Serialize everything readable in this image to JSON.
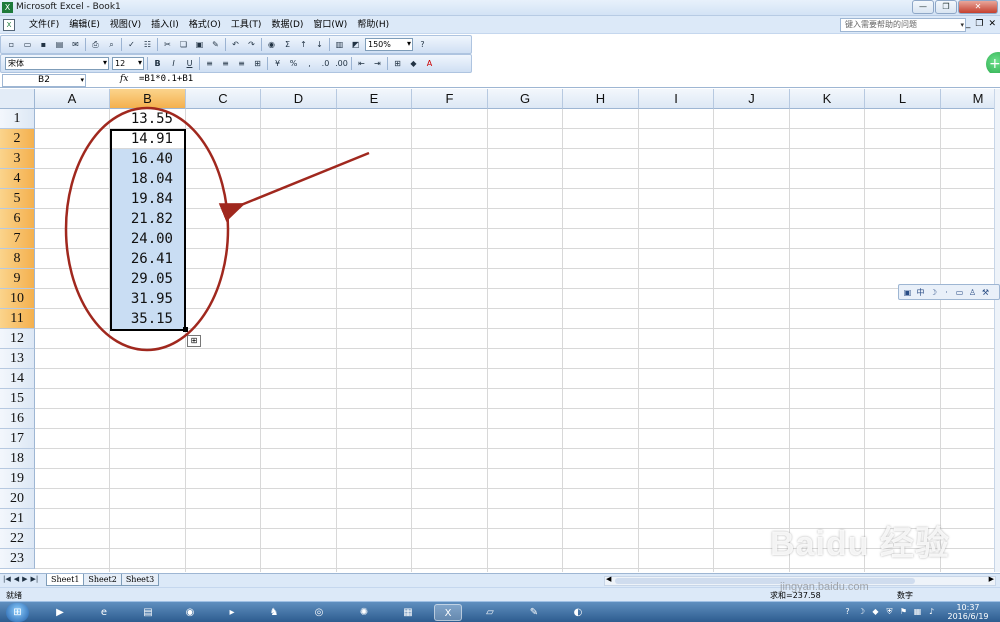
{
  "window": {
    "title": "Microsoft Excel - Book1"
  },
  "menu": {
    "items": [
      "文件(F)",
      "编辑(E)",
      "视图(V)",
      "插入(I)",
      "格式(O)",
      "工具(T)",
      "数据(D)",
      "窗口(W)",
      "帮助(H)"
    ],
    "help_placeholder": "键入需要帮助的问题"
  },
  "toolbar": {
    "zoom": "150%"
  },
  "format_toolbar": {
    "font": "宋体",
    "size": "12",
    "bold": "B",
    "italic": "I",
    "underline": "U"
  },
  "formula_bar": {
    "name_box": "B2",
    "fx": "fx",
    "formula": "=B1*0.1+B1"
  },
  "grid": {
    "columns": [
      "A",
      "B",
      "C",
      "D",
      "E",
      "F",
      "G",
      "H",
      "I",
      "J",
      "K",
      "L",
      "M"
    ],
    "selected_column": "B",
    "rows": [
      "1",
      "2",
      "3",
      "4",
      "5",
      "6",
      "7",
      "8",
      "9",
      "10",
      "11",
      "12",
      "13",
      "14",
      "15",
      "16",
      "17",
      "18",
      "19",
      "20",
      "21",
      "22",
      "23"
    ],
    "selected_rows": [
      "2",
      "3",
      "4",
      "5",
      "6",
      "7",
      "8",
      "9",
      "10",
      "11"
    ],
    "column_b_values": [
      "13.55",
      "14.91",
      "16.40",
      "18.04",
      "19.84",
      "21.82",
      "24.00",
      "26.41",
      "29.05",
      "31.95",
      "35.15"
    ]
  },
  "sheets": {
    "tabs": [
      "Sheet1",
      "Sheet2",
      "Sheet3"
    ],
    "active": "Sheet1"
  },
  "status": {
    "ready": "就绪",
    "sum": "求和=237.58",
    "mode": "数字"
  },
  "taskbar": {
    "time": "10:37",
    "date": "2016/6/19"
  },
  "watermark": {
    "text": "Baidu 经验",
    "url": "jingyan.baidu.com"
  },
  "colors": {
    "annotation": "#a0281e",
    "selection_fill": "#c9ddf3",
    "header_selected": "#f4b04e"
  }
}
